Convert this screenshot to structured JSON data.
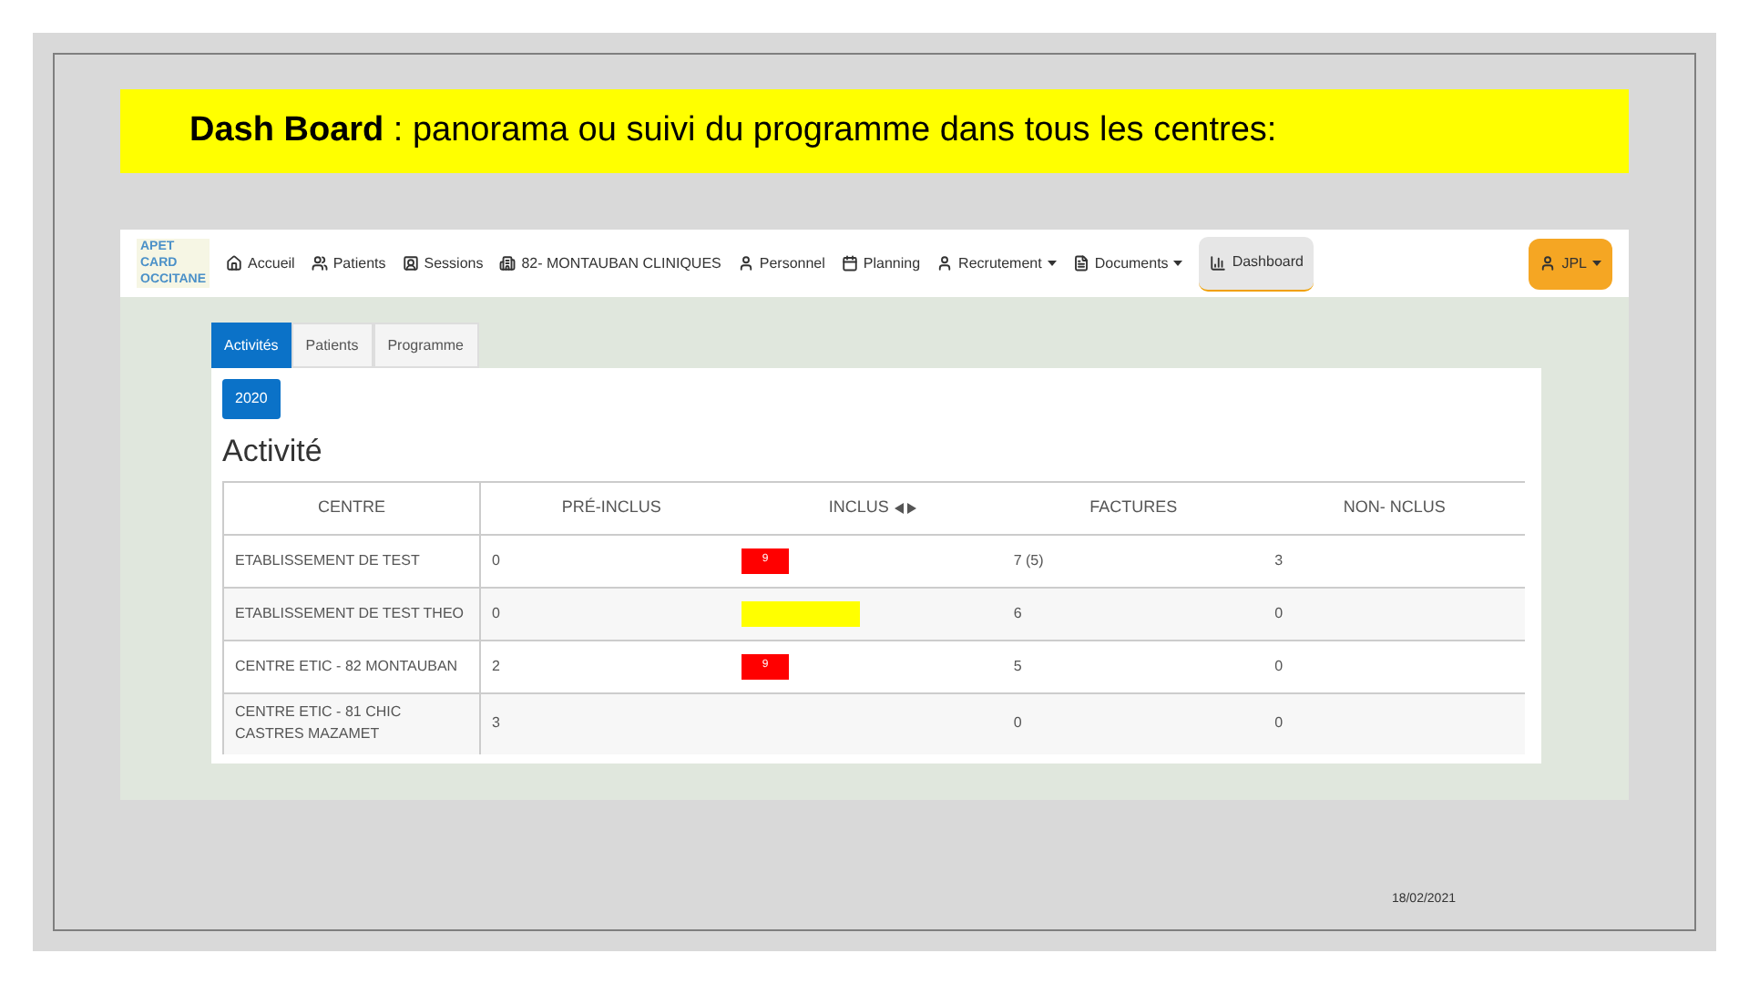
{
  "slide_title": {
    "bold_part": "Dash Board",
    "rest": " : panorama ou suivi du programme dans tous les centres:"
  },
  "navbar": {
    "logo": [
      "APET",
      "CARD",
      "OCCITANE"
    ],
    "items": [
      {
        "label": "Accueil",
        "kind": "home",
        "dropdown": false,
        "selected": false
      },
      {
        "label": "Patients",
        "kind": "users",
        "dropdown": false,
        "selected": false
      },
      {
        "label": "Sessions",
        "kind": "sessions",
        "dropdown": false,
        "selected": false
      },
      {
        "label": "82- MONTAUBAN CLINIQUES",
        "kind": "building",
        "dropdown": false,
        "selected": false
      },
      {
        "label": "Personnel",
        "kind": "user",
        "dropdown": false,
        "selected": false
      },
      {
        "label": "Planning",
        "kind": "calendar",
        "dropdown": false,
        "selected": false
      },
      {
        "label": "Recrutement",
        "kind": "user",
        "dropdown": true,
        "selected": false
      },
      {
        "label": "Documents",
        "kind": "file",
        "dropdown": true,
        "selected": false
      },
      {
        "label": "Dashboard",
        "kind": "chart",
        "dropdown": false,
        "selected": true
      }
    ],
    "user_button": "JPL"
  },
  "tabs": [
    {
      "label": "Activités",
      "selected": true
    },
    {
      "label": "Patients",
      "selected": false
    },
    {
      "label": "Programme",
      "selected": false
    }
  ],
  "year_button": "2020",
  "section_title": "Activité",
  "table": {
    "columns": [
      "CENTRE",
      "PRÉ-INCLUS",
      "INCLUS",
      "FACTURES",
      "NON- NCLUS"
    ],
    "rows": [
      {
        "centre": "ETABLISSEMENT DE TEST",
        "pre_inclus": "0",
        "inclus": {
          "label": "9",
          "color": "#ff0000"
        },
        "factures": "7 (5)",
        "non_inclus": "3"
      },
      {
        "centre": "ETABLISSEMENT DE TEST THEO",
        "pre_inclus": "0",
        "inclus": {
          "color": "#ffff00"
        },
        "factures": "6",
        "non_inclus": "0"
      },
      {
        "centre": "CENTRE ETIC - 82 MONTAUBAN",
        "pre_inclus": "2",
        "inclus": {
          "label": "9",
          "color": "#ff0000"
        },
        "factures": "5",
        "non_inclus": "0"
      },
      {
        "centre": "CENTRE ETIC - 81 CHIC CASTRES MAZAMET",
        "pre_inclus": "3",
        "factures": "0",
        "non_inclus": "0"
      }
    ]
  },
  "footer_date": "18/02/2021"
}
